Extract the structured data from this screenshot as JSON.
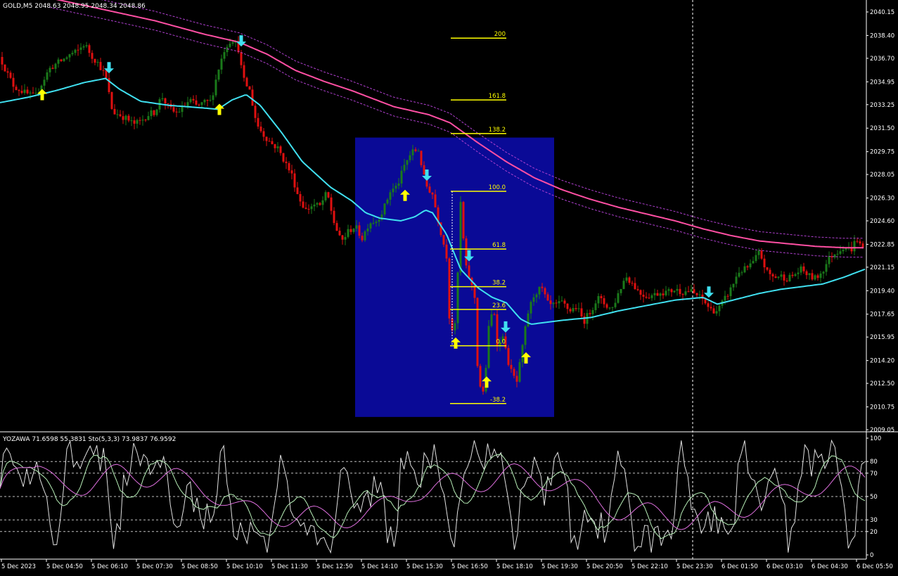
{
  "header": {
    "main": "GOLD,M5  2048.63 2048.95 2048.34 2048.86",
    "osc": "YOZAWA 71.6598 55.3831  Sto(5,3,3) 73.9837 76.9592"
  },
  "colors": {
    "background": "#000000",
    "bull": "#1a7a1a",
    "bear": "#e01010",
    "fast_ma": "#40e0f0",
    "slow_ma": "#ff4fa3",
    "band": "#b040d0",
    "zone": "#0a0a96",
    "fib": "#ffff00",
    "up_arrow": "#ffff00",
    "down_arrow": "#40e0f0"
  },
  "chart_data": [
    {
      "type": "bar",
      "series_name": "GOLD,M5",
      "ylim": [
        2009.05,
        2040.15
      ],
      "y_ticks": [
        "2040.15",
        "2038.40",
        "2036.70",
        "2034.95",
        "2033.25",
        "2031.50",
        "2029.75",
        "2028.05",
        "2026.30",
        "2024.60",
        "2022.85",
        "2021.15",
        "2019.40",
        "2017.65",
        "2015.95",
        "2014.20",
        "2012.50",
        "2010.75",
        "2009.05"
      ],
      "x_ticks": [
        "5 Dec 2023",
        "5 Dec 04:50",
        "5 Dec 06:10",
        "5 Dec 07:30",
        "5 Dec 08:50",
        "5 Dec 10:10",
        "5 Dec 11:30",
        "5 Dec 12:50",
        "5 Dec 14:10",
        "5 Dec 15:30",
        "5 Dec 16:50",
        "5 Dec 18:10",
        "5 Dec 19:30",
        "5 Dec 20:50",
        "5 Dec 22:10",
        "5 Dec 23:30",
        "6 Dec 01:50",
        "6 Dec 03:10",
        "6 Dec 04:30",
        "6 Dec 05:50"
      ],
      "price_path": [
        [
          0,
          2036.8
        ],
        [
          10,
          2035.6
        ],
        [
          20,
          2034.6
        ],
        [
          30,
          2034.3
        ],
        [
          40,
          2034.0
        ],
        [
          50,
          2033.8
        ],
        [
          60,
          2034.9
        ],
        [
          70,
          2035.9
        ],
        [
          80,
          2036.3
        ],
        [
          90,
          2036.6
        ],
        [
          100,
          2037.0
        ],
        [
          110,
          2037.2
        ],
        [
          120,
          2037.8
        ],
        [
          130,
          2036.9
        ],
        [
          140,
          2036.3
        ],
        [
          150,
          2035.4
        ],
        [
          160,
          2032.7
        ],
        [
          170,
          2032.5
        ],
        [
          180,
          2032.2
        ],
        [
          190,
          2031.8
        ],
        [
          200,
          2032.0
        ],
        [
          210,
          2032.5
        ],
        [
          220,
          2032.7
        ],
        [
          230,
          2033.9
        ],
        [
          240,
          2033.0
        ],
        [
          250,
          2032.6
        ],
        [
          260,
          2033.0
        ],
        [
          270,
          2033.6
        ],
        [
          280,
          2033.1
        ],
        [
          290,
          2033.4
        ],
        [
          300,
          2033.5
        ],
        [
          310,
          2035.8
        ],
        [
          320,
          2037.5
        ],
        [
          330,
          2038.2
        ],
        [
          340,
          2037.3
        ],
        [
          345,
          2035.2
        ],
        [
          355,
          2034.3
        ],
        [
          365,
          2031.8
        ],
        [
          375,
          2031.0
        ],
        [
          385,
          2030.4
        ],
        [
          395,
          2030.0
        ],
        [
          405,
          2029.0
        ],
        [
          415,
          2028.0
        ],
        [
          425,
          2026.3
        ],
        [
          435,
          2025.4
        ],
        [
          445,
          2025.8
        ],
        [
          455,
          2025.7
        ],
        [
          465,
          2026.7
        ],
        [
          475,
          2024.5
        ],
        [
          485,
          2023.0
        ],
        [
          495,
          2023.8
        ],
        [
          505,
          2024.2
        ],
        [
          515,
          2023.3
        ],
        [
          525,
          2024.5
        ],
        [
          535,
          2024.6
        ],
        [
          545,
          2025.4
        ],
        [
          555,
          2026.8
        ],
        [
          565,
          2027.2
        ],
        [
          575,
          2028.7
        ],
        [
          585,
          2029.7
        ],
        [
          595,
          2029.9
        ],
        [
          605,
          2027.3
        ],
        [
          615,
          2026.6
        ],
        [
          625,
          2024.2
        ],
        [
          635,
          2022.0
        ],
        [
          640,
          2016.4
        ],
        [
          648,
          2016.8
        ],
        [
          655,
          2025.9
        ],
        [
          662,
          2021.2
        ],
        [
          668,
          2020.3
        ],
        [
          675,
          2018.9
        ],
        [
          680,
          2012.7
        ],
        [
          688,
          2011.6
        ],
        [
          695,
          2016.6
        ],
        [
          702,
          2018.3
        ],
        [
          708,
          2015.0
        ],
        [
          715,
          2016.2
        ],
        [
          720,
          2014.6
        ],
        [
          728,
          2013.2
        ],
        [
          735,
          2012.6
        ],
        [
          742,
          2014.8
        ],
        [
          750,
          2017.6
        ],
        [
          760,
          2019.2
        ],
        [
          770,
          2019.6
        ],
        [
          780,
          2018.3
        ],
        [
          790,
          2018.3
        ],
        [
          800,
          2018.5
        ],
        [
          810,
          2017.9
        ],
        [
          820,
          2018.2
        ],
        [
          830,
          2017.1
        ],
        [
          840,
          2017.9
        ],
        [
          850,
          2018.9
        ],
        [
          860,
          2018.4
        ],
        [
          870,
          2018.0
        ],
        [
          880,
          2019.3
        ],
        [
          890,
          2020.5
        ],
        [
          900,
          2019.9
        ],
        [
          910,
          2019.2
        ],
        [
          920,
          2019.0
        ],
        [
          930,
          2019.1
        ],
        [
          940,
          2019.3
        ],
        [
          950,
          2019.3
        ],
        [
          960,
          2019.5
        ],
        [
          970,
          2019.3
        ],
        [
          980,
          2019.4
        ],
        [
          990,
          2019.1
        ],
        [
          1000,
          2018.7
        ],
        [
          1010,
          2018.0
        ],
        [
          1020,
          2017.9
        ],
        [
          1030,
          2018.7
        ],
        [
          1040,
          2019.6
        ],
        [
          1050,
          2020.8
        ],
        [
          1060,
          2021.0
        ],
        [
          1070,
          2021.4
        ],
        [
          1080,
          2022.3
        ],
        [
          1090,
          2020.8
        ],
        [
          1100,
          2020.4
        ],
        [
          1110,
          2020.5
        ],
        [
          1120,
          2020.3
        ],
        [
          1130,
          2020.6
        ],
        [
          1140,
          2021.0
        ],
        [
          1150,
          2020.5
        ],
        [
          1160,
          2020.3
        ],
        [
          1170,
          2020.9
        ],
        [
          1180,
          2021.9
        ],
        [
          1190,
          2022.3
        ],
        [
          1200,
          2022.7
        ],
        [
          1210,
          2022.4
        ],
        [
          1218,
          2023.3
        ],
        [
          1225,
          2022.6
        ],
        [
          1230,
          2022.5
        ]
      ],
      "fast_ma": [
        [
          0,
          2033.4
        ],
        [
          40,
          2033.8
        ],
        [
          80,
          2034.3
        ],
        [
          120,
          2034.9
        ],
        [
          150,
          2035.2
        ],
        [
          170,
          2034.4
        ],
        [
          200,
          2033.5
        ],
        [
          240,
          2033.2
        ],
        [
          290,
          2033.0
        ],
        [
          310,
          2032.9
        ],
        [
          330,
          2033.6
        ],
        [
          350,
          2034.0
        ],
        [
          370,
          2033.2
        ],
        [
          400,
          2031.2
        ],
        [
          430,
          2029.0
        ],
        [
          470,
          2027.1
        ],
        [
          500,
          2026.1
        ],
        [
          520,
          2025.2
        ],
        [
          540,
          2024.8
        ],
        [
          570,
          2024.6
        ],
        [
          590,
          2024.9
        ],
        [
          605,
          2025.4
        ],
        [
          615,
          2025.2
        ],
        [
          635,
          2023.6
        ],
        [
          655,
          2021.0
        ],
        [
          680,
          2019.6
        ],
        [
          700,
          2018.9
        ],
        [
          720,
          2018.5
        ],
        [
          740,
          2017.3
        ],
        [
          755,
          2016.9
        ],
        [
          800,
          2017.2
        ],
        [
          840,
          2017.4
        ],
        [
          880,
          2017.9
        ],
        [
          920,
          2018.3
        ],
        [
          960,
          2018.7
        ],
        [
          1000,
          2018.9
        ],
        [
          1020,
          2018.4
        ],
        [
          1050,
          2018.8
        ],
        [
          1080,
          2019.2
        ],
        [
          1110,
          2019.5
        ],
        [
          1140,
          2019.7
        ],
        [
          1170,
          2019.9
        ],
        [
          1200,
          2020.4
        ],
        [
          1230,
          2021.0
        ]
      ],
      "slow_ma": [
        [
          70,
          2041.2
        ],
        [
          150,
          2040.3
        ],
        [
          220,
          2039.5
        ],
        [
          290,
          2038.5
        ],
        [
          340,
          2037.9
        ],
        [
          380,
          2037.0
        ],
        [
          420,
          2035.8
        ],
        [
          460,
          2035.0
        ],
        [
          500,
          2034.3
        ],
        [
          560,
          2033.1
        ],
        [
          610,
          2032.5
        ],
        [
          640,
          2031.9
        ],
        [
          680,
          2030.4
        ],
        [
          720,
          2029.0
        ],
        [
          760,
          2027.8
        ],
        [
          800,
          2026.9
        ],
        [
          840,
          2026.2
        ],
        [
          880,
          2025.6
        ],
        [
          920,
          2025.1
        ],
        [
          960,
          2024.6
        ],
        [
          1000,
          2024.0
        ],
        [
          1040,
          2023.5
        ],
        [
          1080,
          2023.1
        ],
        [
          1120,
          2022.9
        ],
        [
          1160,
          2022.7
        ],
        [
          1200,
          2022.6
        ],
        [
          1230,
          2022.6
        ]
      ],
      "band_offset": 0.7,
      "up_arrows": [
        [
          60,
          2034.0
        ],
        [
          312,
          2032.9
        ],
        [
          576,
          2026.5
        ],
        [
          648,
          2015.5
        ],
        [
          692,
          2012.6
        ],
        [
          748,
          2014.4
        ]
      ],
      "down_arrows": [
        [
          155,
          2036.0
        ],
        [
          343,
          2038.0
        ],
        [
          607,
          2028.0
        ],
        [
          667,
          2022.0
        ],
        [
          719,
          2016.7
        ],
        [
          1008,
          2019.3
        ]
      ],
      "zone": {
        "x0": 505,
        "x1": 788,
        "top": 2030.8,
        "bottom": 2010.0
      },
      "fib_levels": [
        {
          "label": "200",
          "price": 2038.2
        },
        {
          "label": "161.8",
          "price": 2033.6
        },
        {
          "label": "138.2",
          "price": 2031.1
        },
        {
          "label": "100.0",
          "price": 2026.8
        },
        {
          "label": "61.8",
          "price": 2022.5
        },
        {
          "label": "38.2",
          "price": 2019.7
        },
        {
          "label": "23.6",
          "price": 2018.0
        },
        {
          "label": "0.0",
          "price": 2015.3
        },
        {
          "label": "-38.2",
          "price": 2011.0
        }
      ],
      "vline_x": 985
    },
    {
      "type": "line",
      "series_name": "YOZAWA / Sto(5,3,3)",
      "ylim": [
        0,
        100
      ],
      "y_ticks": [
        "100",
        "80",
        "70",
        "50",
        "30",
        "20",
        "0"
      ],
      "levels": [
        80,
        70,
        50,
        30,
        20
      ],
      "seed": 7
    }
  ]
}
